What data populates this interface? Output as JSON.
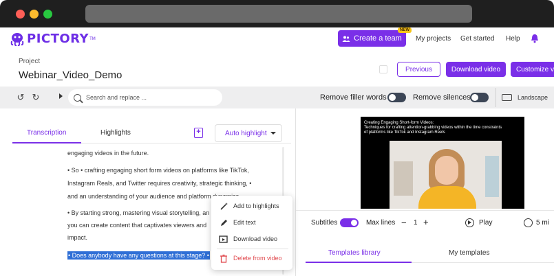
{
  "nav": {
    "logo": "PICTORY",
    "logo_tm": "TM",
    "create_team": "Create a team",
    "new_badge": "NEW",
    "my_projects": "My projects",
    "get_started": "Get started",
    "help": "Help"
  },
  "project": {
    "label": "Project",
    "name": "Webinar_Video_Demo",
    "previous": "Previous",
    "download": "Download video",
    "customize": "Customize vi"
  },
  "toolbar": {
    "search_placeholder": "Search and replace ...",
    "remove_filler": "Remove filler words",
    "remove_silences": "Remove silences",
    "landscape": "Landscape"
  },
  "left": {
    "tab_transcription": "Transcription",
    "tab_highlights": "Highlights",
    "auto_highlight": "Auto highlight",
    "lines": [
      "engaging videos in the future.",
      "• So • crafting engaging short form videos on platforms like TikTok,",
      "Instagram Reals, and Twitter requires creativity, strategic thinking, •",
      "and an understanding of your audience and platform dynamics.",
      "• By starting strong, mastering visual storytelling, an",
      "you can create content that captivates viewers and",
      "impact."
    ],
    "highlighted_line": "• Does anybody have any questions at this stage? •"
  },
  "context_menu": {
    "items": [
      {
        "label": "Add to highlights",
        "icon": "magic-wand-icon"
      },
      {
        "label": "Edit text",
        "icon": "pencil-icon"
      },
      {
        "label": "Download video",
        "icon": "download-video-icon"
      },
      {
        "label": "Delete from video",
        "icon": "trash-icon"
      }
    ]
  },
  "video": {
    "title_lines": [
      "Creating Engaging Short-form Videos:",
      "Techniques for crafting attention-grabbing videos within the time constraints",
      "of platforms like TikTok and Instagram Reels"
    ]
  },
  "controls": {
    "subtitles": "Subtitles",
    "max_lines": "Max lines",
    "minus": "−",
    "max_lines_value": "1",
    "plus": "+",
    "play": "Play",
    "duration": "5 mi"
  },
  "templates": {
    "tab_library": "Templates library",
    "tab_mine": "My templates"
  },
  "colors": {
    "accent": "#7a2fe8",
    "selection": "#2f6fd6",
    "danger": "#e0494e"
  }
}
